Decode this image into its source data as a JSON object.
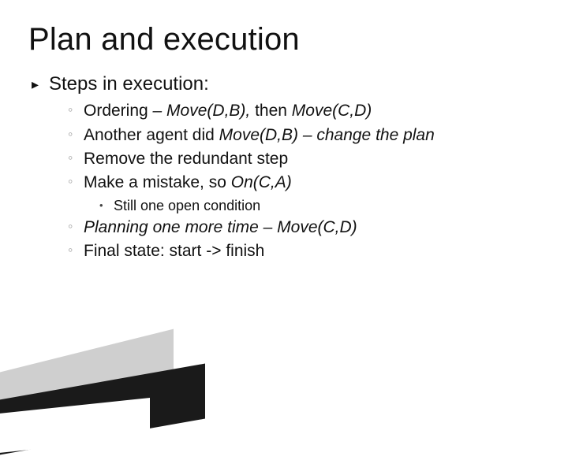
{
  "title": "Plan and execution",
  "sections": {
    "heading": "Steps in execution:",
    "items": [
      {
        "text": "Ordering ",
        "italic": "– Move(D,B), ",
        "tail": "then ",
        "italic2": "Move(C,D)"
      },
      {
        "text": "Another agent did ",
        "italic": "Move(D,B) – change the plan"
      },
      {
        "text": "Remove the redundant step"
      },
      {
        "text": "Make a mistake, so ",
        "italic": "On(C,A)"
      }
    ],
    "subnote": "Still one open condition",
    "items_after": [
      {
        "italic": "Planning one more time – Move(C,D)"
      },
      {
        "text": "Final state: start -> finish"
      }
    ]
  },
  "bullets": {
    "lvl1": "▸",
    "lvl2": "◦",
    "lvl3": "•"
  }
}
